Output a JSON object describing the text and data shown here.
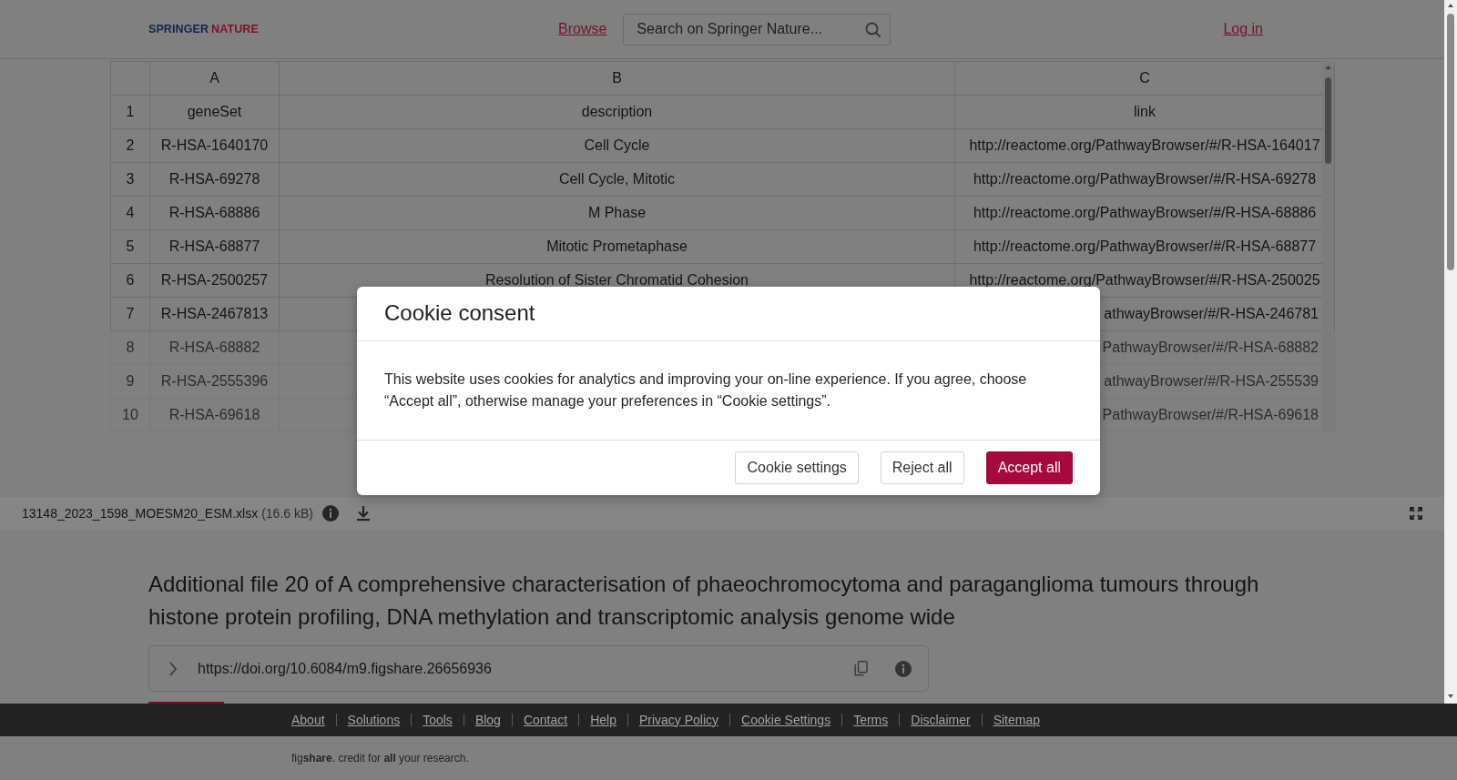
{
  "header": {
    "logo": [
      "SPRINGER",
      "NATURE"
    ],
    "browse_link": "Browse",
    "search": {
      "placeholder": "Search on Springer Nature..."
    },
    "login_link": "Log in"
  },
  "spreadsheet": {
    "columns": [
      "A",
      "B",
      "C"
    ],
    "rows": [
      {
        "number": "1",
        "a": "geneSet",
        "b": "description",
        "c": "link",
        "faded": false
      },
      {
        "number": "2",
        "a": "R-HSA-1640170",
        "b": "Cell Cycle",
        "c": "http://reactome.org/PathwayBrowser/#/R-HSA-164017",
        "faded": false
      },
      {
        "number": "3",
        "a": "R-HSA-69278",
        "b": "Cell Cycle, Mitotic",
        "c": "http://reactome.org/PathwayBrowser/#/R-HSA-69278",
        "faded": false
      },
      {
        "number": "4",
        "a": "R-HSA-68886",
        "b": "M Phase",
        "c": "http://reactome.org/PathwayBrowser/#/R-HSA-68886",
        "faded": false
      },
      {
        "number": "5",
        "a": "R-HSA-68877",
        "b": "Mitotic Prometaphase",
        "c": "http://reactome.org/PathwayBrowser/#/R-HSA-68877",
        "faded": false
      },
      {
        "number": "6",
        "a": "R-HSA-2500257",
        "b": "Resolution of Sister Chromatid Cohesion",
        "c": "http://reactome.org/PathwayBrowser/#/R-HSA-250025",
        "faded": false
      },
      {
        "number": "7",
        "a": "R-HSA-2467813",
        "c": "athwayBrowser/#/R-HSA-246781",
        "faded": false
      },
      {
        "number": "8",
        "a": "R-HSA-68882",
        "c": "PathwayBrowser/#/R-HSA-68882",
        "faded": true
      },
      {
        "number": "9",
        "a": "R-HSA-2555396",
        "c": "athwayBrowser/#/R-HSA-255539",
        "faded": true
      },
      {
        "number": "10",
        "a": "R-HSA-69618",
        "c": "PathwayBrowser/#/R-HSA-69618",
        "faded": true
      }
    ]
  },
  "file_bar": {
    "filename": "13148_2023_1598_MOESM20_ESM.xlsx",
    "size": "(16.6 kB)"
  },
  "item": {
    "title": "Additional file 20 of A comprehensive characterisation of phaeochromocytoma and paraganglioma tumours through histone protein profiling, DNA methylation and transcriptomic analysis genome wide",
    "doi": "https://doi.org/10.6084/m9.figshare.26656936"
  },
  "footer": {
    "links": [
      "About",
      "Solutions",
      "Tools",
      "Blog",
      "Contact",
      "Help",
      "Privacy Policy",
      "Cookie Settings",
      "Terms",
      "Disclaimer",
      "Sitemap"
    ],
    "tagline": "fig**share**. credit for **all** your research."
  },
  "cookie_dialog": {
    "title": "Cookie consent",
    "message": "This website uses cookies for analytics and improving your on-line experience. If you agree, choose “Accept all”, otherwise manage your preferences in “Cookie settings”.",
    "buttons": [
      {
        "label": "Cookie settings",
        "kind": "outline"
      },
      {
        "label": "Reject all",
        "kind": "outline"
      },
      {
        "label": "Accept all",
        "kind": "primary"
      }
    ]
  }
}
